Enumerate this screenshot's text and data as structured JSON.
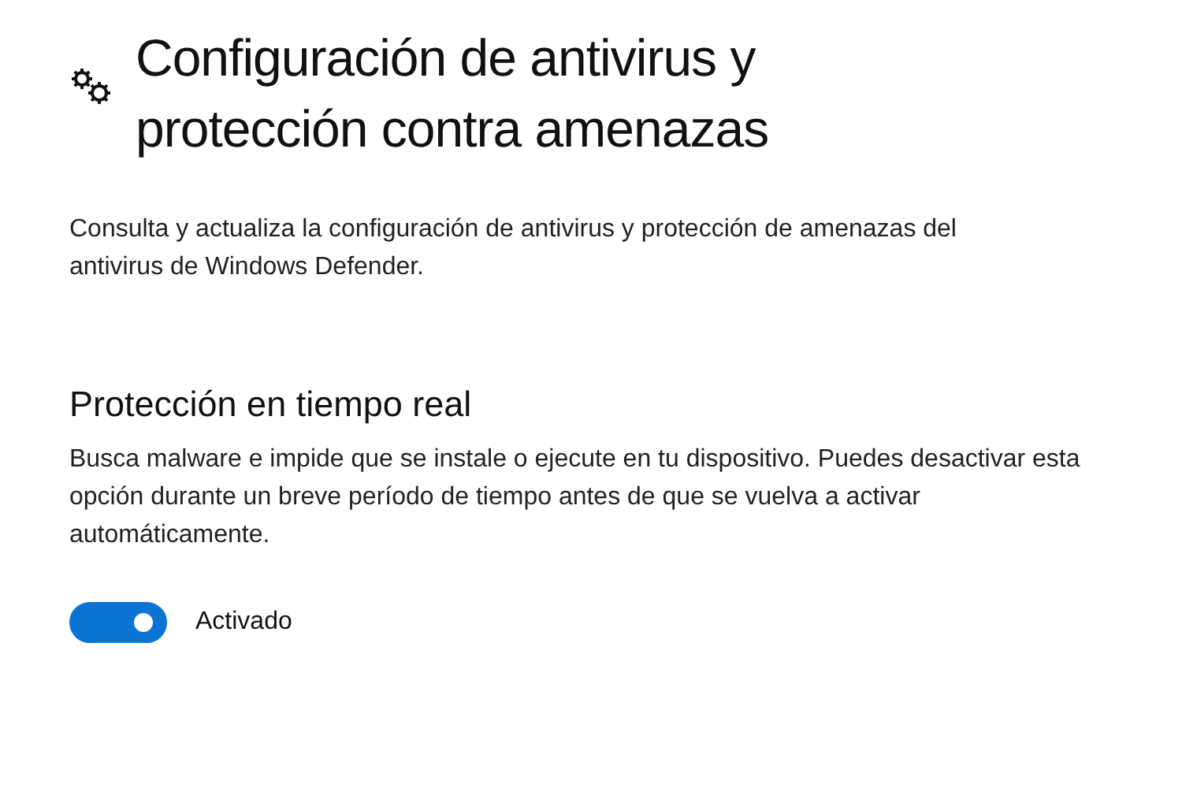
{
  "header": {
    "title": "Configuración de antivirus y protección contra amenazas"
  },
  "description": "Consulta y actualiza la configuración de antivirus y protección de amenazas del antivirus de Windows Defender.",
  "section": {
    "title": "Protección en tiempo real",
    "description": "Busca malware e impide que se instale o ejecute en tu dispositivo. Puedes desactivar esta opción durante un breve período de tiempo antes de que se vuelva a activar automáticamente.",
    "toggle": {
      "on": true,
      "label": "Activado"
    }
  }
}
